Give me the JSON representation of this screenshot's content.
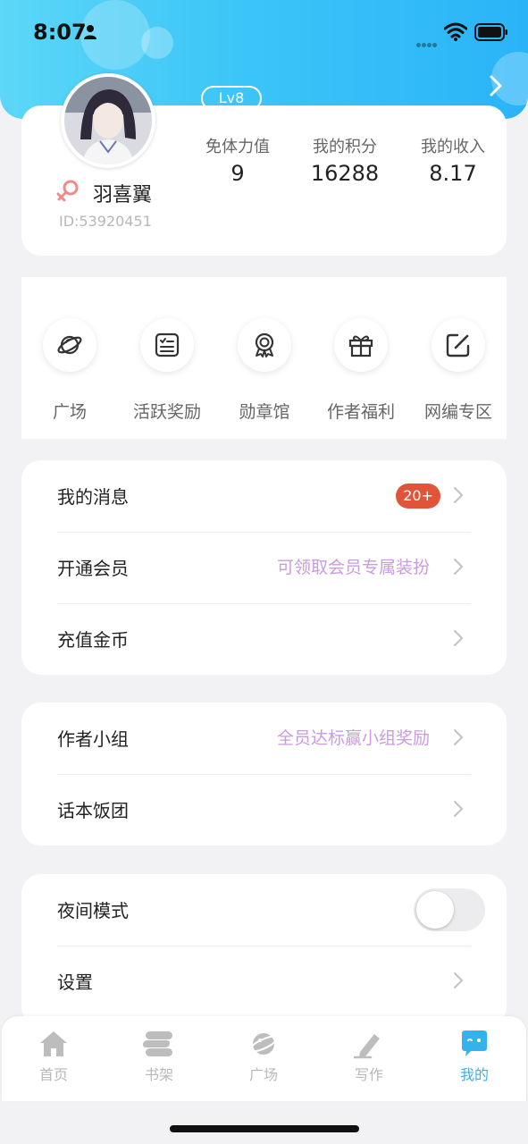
{
  "status_bar": {
    "time": "8:07"
  },
  "profile": {
    "level": "Lv8",
    "username": "羽喜翼",
    "user_id": "ID:53920451",
    "stats": [
      {
        "label": "免体力值",
        "value": "9"
      },
      {
        "label": "我的积分",
        "value": "16288"
      },
      {
        "label": "我的收入",
        "value": "8.17"
      }
    ]
  },
  "quick_actions": [
    {
      "label": "广场",
      "icon": "planet-icon"
    },
    {
      "label": "活跃奖励",
      "icon": "checklist-icon"
    },
    {
      "label": "勋章馆",
      "icon": "medal-icon"
    },
    {
      "label": "作者福利",
      "icon": "gift-icon"
    },
    {
      "label": "网编专区",
      "icon": "edit-icon"
    }
  ],
  "menu_group_1": {
    "messages": {
      "label": "我的消息",
      "badge": "20+"
    },
    "membership": {
      "label": "开通会员",
      "hint": "可领取会员专属装扮"
    },
    "recharge": {
      "label": "充值金币"
    }
  },
  "menu_group_2": {
    "author_group": {
      "label": "作者小组",
      "hint": "全员达标赢小组奖励"
    },
    "fan_club": {
      "label": "话本饭团"
    }
  },
  "menu_group_3": {
    "night_mode": {
      "label": "夜间模式",
      "enabled": false
    },
    "settings": {
      "label": "设置"
    }
  },
  "tab_bar": [
    {
      "label": "首页",
      "icon": "home-icon",
      "active": false
    },
    {
      "label": "书架",
      "icon": "bookshelf-icon",
      "active": false
    },
    {
      "label": "广场",
      "icon": "planet-icon",
      "active": false
    },
    {
      "label": "写作",
      "icon": "pen-icon",
      "active": false
    },
    {
      "label": "我的",
      "icon": "chat-bubble-icon",
      "active": true
    }
  ],
  "colors": {
    "header_gradient_start": "#5cd7f7",
    "header_gradient_end": "#2ab4f8",
    "accent_active_tab": "#35b2ea",
    "badge_red": "#e0553a",
    "hint_purple": "#c99be0"
  }
}
